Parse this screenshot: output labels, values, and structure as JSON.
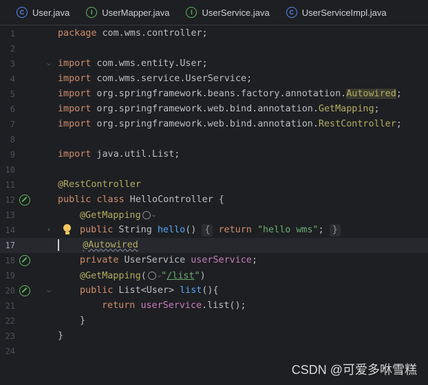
{
  "tabs": [
    {
      "label": "User.java",
      "kind": "class",
      "icon": "class-icon"
    },
    {
      "label": "UserMapper.java",
      "kind": "interface",
      "icon": "interface-icon"
    },
    {
      "label": "UserService.java",
      "kind": "interface",
      "icon": "interface-icon"
    },
    {
      "label": "UserServiceImpl.java",
      "kind": "class",
      "icon": "class-icon"
    }
  ],
  "lines": [
    {
      "n": "1"
    },
    {
      "n": "2"
    },
    {
      "n": "3"
    },
    {
      "n": "4"
    },
    {
      "n": "5"
    },
    {
      "n": "6"
    },
    {
      "n": "7"
    },
    {
      "n": "8"
    },
    {
      "n": "9"
    },
    {
      "n": "10"
    },
    {
      "n": "11"
    },
    {
      "n": "12"
    },
    {
      "n": "13"
    },
    {
      "n": "14"
    },
    {
      "n": "17"
    },
    {
      "n": "18"
    },
    {
      "n": "19"
    },
    {
      "n": "20"
    },
    {
      "n": "21"
    },
    {
      "n": "22"
    },
    {
      "n": "23"
    },
    {
      "n": "24"
    }
  ],
  "code": {
    "l1_pkg": "package",
    "l1_rest": " com.wms.controller;",
    "import": "import",
    "l3": " com.wms.entity.User;",
    "l4": " com.wms.service.UserService;",
    "l5_a": " org.springframework.beans.factory.annotation.",
    "l5_b": "Autowired",
    "l6_a": " org.springframework.web.bind.annotation.",
    "l6_b": "GetMapping",
    "l7_a": " org.springframework.web.bind.annotation.",
    "l7_b": "RestController",
    "l9": " java.util.List;",
    "l11": "@RestController",
    "l12_a": "public class",
    "l12_b": " HelloController {",
    "l13": "@GetMapping",
    "l14_pub": "public",
    "l14_a": " String ",
    "l14_m": "hello",
    "l14_b": "()",
    "l14_open": "{",
    "l14_ret": "return",
    "l14_str": "\"hello wms\"",
    "l14_semi": ";",
    "l14_close": "}",
    "l17": "@Autowired",
    "l18_kw": "private",
    "l18_a": " UserService ",
    "l18_f": "userService",
    "l18_b": ";",
    "l19_ann": "@GetMapping",
    "l19_a": "(",
    "l19_s1": "\"",
    "l19_s2": "/list",
    "l19_s3": "\"",
    "l19_b": ")",
    "l20_kw": "public",
    "l20_a": " List<User> ",
    "l20_m": "list",
    "l20_b": "(){",
    "l21_kw": "return",
    "l21_f": "userService",
    "l21_a": ".list();",
    "l22": "}",
    "l23": "}",
    "semi": ";"
  },
  "watermark": "CSDN @可爱多咻雪糕",
  "colors": {
    "background": "#1e1f22",
    "keyword": "#cf8e6d",
    "annotation": "#b3ae60",
    "string": "#6aab73",
    "field": "#c77dbb",
    "method": "#56a8f5"
  }
}
